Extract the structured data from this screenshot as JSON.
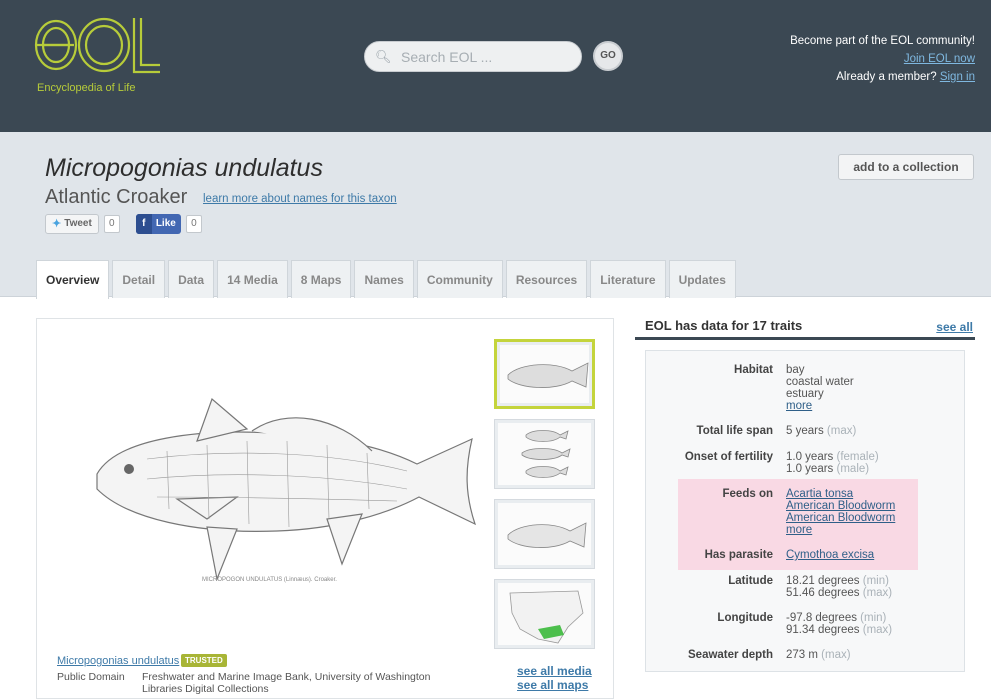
{
  "header": {
    "logo_text": "eOL",
    "logo_subtitle": "Encyclopedia of Life",
    "search_placeholder": "Search EOL ...",
    "search_go": "GO",
    "community_line": "Become part of the EOL community!",
    "join_link": "Join EOL now",
    "member_line": "Already a member?",
    "signin_link": "Sign in"
  },
  "taxon": {
    "scientific_name": "Micropogonias undulatus",
    "common_name": "Atlantic Croaker",
    "names_link": "learn more about names for this taxon",
    "add_collection": "add to a collection",
    "tweet": "Tweet",
    "tweet_count": "0",
    "like": "Like",
    "like_count": "0"
  },
  "tabs": [
    {
      "label": "Overview",
      "active": true
    },
    {
      "label": "Detail"
    },
    {
      "label": "Data"
    },
    {
      "label": "14 Media"
    },
    {
      "label": "8 Maps"
    },
    {
      "label": "Names"
    },
    {
      "label": "Community"
    },
    {
      "label": "Resources"
    },
    {
      "label": "Literature"
    },
    {
      "label": "Updates"
    }
  ],
  "media": {
    "figure_caption": "MICROPOGON UNDULATUS (Linnæus). Croaker.",
    "caption_link": "Micropogonias undulatus",
    "badge": "TRUSTED",
    "license": "Public Domain",
    "attribution": "Freshwater and Marine Image Bank, University of Washington Libraries Digital Collections",
    "see_all_media": "see all media",
    "see_all_maps": "see all maps"
  },
  "traits": {
    "title": "EOL has data for 17 traits",
    "see_all": "see all",
    "habitat_label": "Habitat",
    "habitat_values": [
      "bay",
      "coastal water",
      "estuary"
    ],
    "habitat_more": "more",
    "lifespan_label": "Total life span",
    "lifespan_value": "5 years",
    "lifespan_qual": "(max)",
    "fertility_label": "Onset of fertility",
    "fertility_1": "1.0 years",
    "fertility_1_qual": "(female)",
    "fertility_2": "1.0 years",
    "fertility_2_qual": "(male)",
    "feeds_label": "Feeds on",
    "feeds_values": [
      "Acartia tonsa",
      "American Bloodworm",
      "American Bloodworm"
    ],
    "feeds_more": "more",
    "parasite_label": "Has parasite",
    "parasite_value": "Cymothoa excisa",
    "lat_label": "Latitude",
    "lat_1": "18.21 degrees",
    "lat_1_qual": "(min)",
    "lat_2": "51.46 degrees",
    "lat_2_qual": "(max)",
    "lon_label": "Longitude",
    "lon_1": "-97.8 degrees",
    "lon_1_qual": "(min)",
    "lon_2": "91.34 degrees",
    "lon_2_qual": "(max)",
    "depth_label": "Seawater depth",
    "depth_value": "273 m",
    "depth_qual": "(max)"
  },
  "colors": {
    "header_bg": "#3b4853",
    "logo": "#b7cc3a",
    "highlight": "#f9d9e4",
    "link": "#3e7aa8"
  }
}
